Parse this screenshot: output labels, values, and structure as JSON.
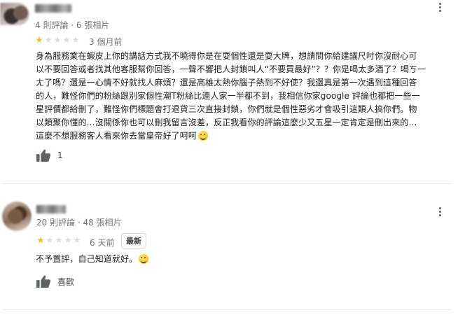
{
  "reviews": [
    {
      "meta": "4 則評論 · 6 張相片",
      "rating": 1,
      "max_rating": 5,
      "time": "3 個月前",
      "text_lines": [
        "身為服務業在蝦皮上你的講話方式我不曉得你是在耍個性還是耍大牌，想請問你給建議尺吋你沒耐心可",
        "以不要回答或者找其他客服幫你回答，一聲不響把人封鎖叫人“不要買最好”？？你是喝太多酒了？喝ㄎ一",
        "ㄤ了嗎？還是一心情不好就找人麻煩？還是高雄太熱你腦子熱到不好使？我還真是第一次遇到這種回答",
        "的人，難怪你們的粉絲跟別家個性潮T粉絲比連人家一半都不到，我相信你家google 評論也都把一些一",
        "星評價都給刪了，難怪你們標題會打退貨三次直接封鎖，你們就是個性惡劣才會吸引這類人搞你們。物",
        "以類聚你懂的…沒關係你也可以刪我留言沒差，反正我看你的評論這麼少又五星一定肯定是刪出來的…",
        "這麼不想服務客人看來你去當皇帝好了呵呵"
      ],
      "like_label": "1"
    },
    {
      "meta": "20 則評論 · 48 張相片",
      "rating": 1,
      "max_rating": 5,
      "time": "6 天前",
      "badge": "最新",
      "text_lines": [
        "不予置評，自己知道就好。"
      ],
      "like_label": "喜歡"
    }
  ],
  "icons": {
    "thumbs_up": "thumbs-up-icon",
    "more": "more-vert-icon",
    "star": "star-icon",
    "emoji_laugh": "grinning-sweat-emoji",
    "emoji_smile": "smiling-emoji"
  },
  "colors": {
    "star_filled": "#fbbc04",
    "star_empty": "#dadce0",
    "meta_text": "#70757a",
    "body_text": "#202124",
    "divider": "#e8eaed"
  }
}
